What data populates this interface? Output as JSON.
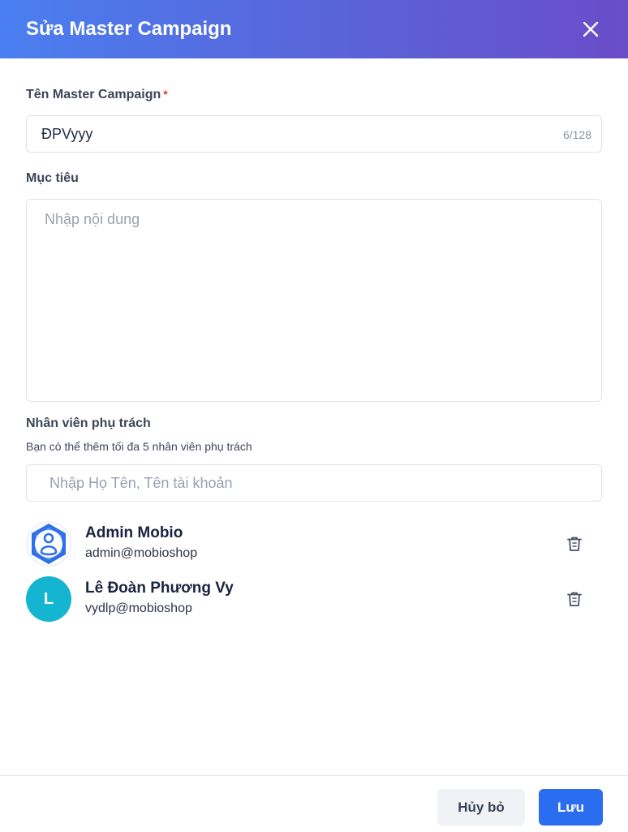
{
  "header": {
    "title": "Sửa Master Campaign"
  },
  "form": {
    "name_label": "Tên Master Campaign",
    "required_mark": "*",
    "name_value": "ĐPVyyy",
    "name_counter": "6/128",
    "goal_label": "Mục tiêu",
    "goal_placeholder": "Nhập nội dung",
    "staff_label": "Nhân viên phụ trách",
    "staff_hint": "Bạn có thể thêm tối đa 5 nhân viên phụ trách",
    "staff_search_placeholder": "Nhập Họ Tên, Tên tài khoản"
  },
  "members": [
    {
      "name": "Admin Mobio",
      "email": "admin@mobioshop",
      "avatar": "person-hexagon-icon"
    },
    {
      "name": "Lê Đoàn Phương Vy",
      "email": "vydlp@mobioshop",
      "avatar_letter": "L",
      "avatar_color": "#14b5d0"
    }
  ],
  "footer": {
    "cancel_label": "Hủy bỏ",
    "save_label": "Lưu"
  },
  "colors": {
    "accent": "#2a6df0",
    "header_start": "#4a7ff0",
    "header_end": "#6a4dc9",
    "required": "#e53935"
  }
}
